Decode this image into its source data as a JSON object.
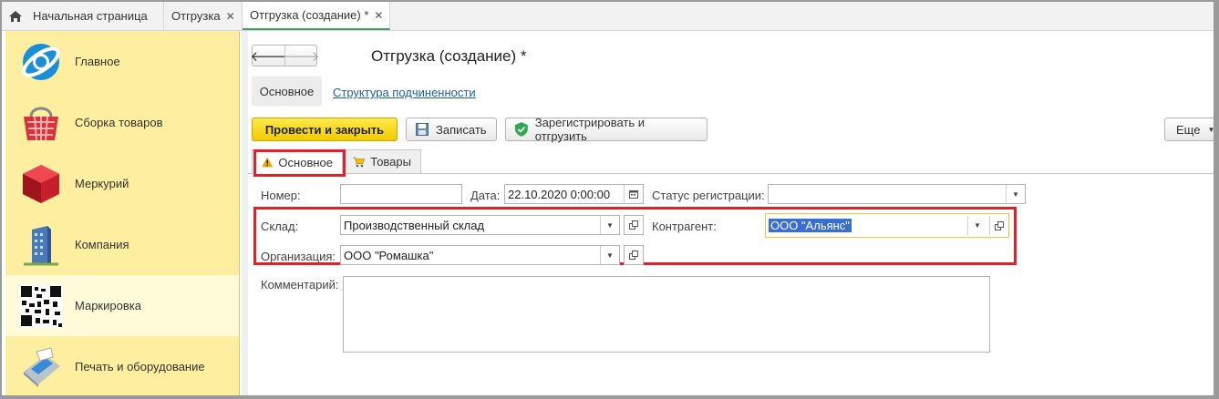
{
  "tabs": [
    {
      "label": "Начальная страница"
    },
    {
      "label": "Отгрузка"
    },
    {
      "label": "Отгрузка (создание) *"
    }
  ],
  "sidebar": {
    "items": [
      {
        "label": "Главное",
        "icon": "globe-icon"
      },
      {
        "label": "Сборка товаров",
        "icon": "basket-icon"
      },
      {
        "label": "Меркурий",
        "icon": "cube-icon"
      },
      {
        "label": "Компания",
        "icon": "building-icon"
      },
      {
        "label": "Маркировка",
        "icon": "qr-code-icon"
      },
      {
        "label": "Печать и оборудование",
        "icon": "terminal-icon"
      }
    ]
  },
  "doc": {
    "title": "Отгрузка (создание) *",
    "subnav": {
      "main": "Основное",
      "structure": "Структура подчиненности"
    }
  },
  "toolbar": {
    "post_close": "Провести и закрыть",
    "save": "Записать",
    "register": "Зарегистрировать и отгрузить",
    "more": "Еще"
  },
  "form_tabs": {
    "main": "Основное",
    "goods": "Товары"
  },
  "form": {
    "number_label": "Номер:",
    "number_value": "",
    "date_label": "Дата:",
    "date_value": "22.10.2020  0:00:00",
    "status_label": "Статус регистрации:",
    "status_value": "",
    "warehouse_label": "Склад:",
    "warehouse_value": "Производственный склад",
    "contractor_label": "Контрагент:",
    "contractor_value": "ООО \"Альянс\"",
    "org_label": "Организация:",
    "org_value": "ООО \"Ромашка\"",
    "comment_label": "Комментарий:",
    "comment_value": ""
  },
  "colors": {
    "accent_yellow": "#f2cc00",
    "highlight_red": "#e0202a",
    "active_tab_green": "#3aa05a"
  }
}
